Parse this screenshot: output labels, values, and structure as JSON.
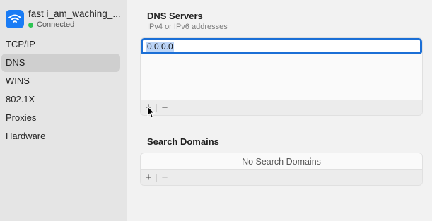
{
  "network": {
    "name": "fast i_am_waching_...",
    "status": "Connected"
  },
  "sidebar": {
    "items": [
      {
        "label": "TCP/IP",
        "selected": false
      },
      {
        "label": "DNS",
        "selected": true
      },
      {
        "label": "WINS",
        "selected": false
      },
      {
        "label": "802.1X",
        "selected": false
      },
      {
        "label": "Proxies",
        "selected": false
      },
      {
        "label": "Hardware",
        "selected": false
      }
    ]
  },
  "dns": {
    "title": "DNS Servers",
    "subtitle": "IPv4 or IPv6 addresses",
    "entries": [
      "0.0.0.0"
    ],
    "add_label": "+",
    "remove_label": "−"
  },
  "search_domains": {
    "title": "Search Domains",
    "empty_label": "No Search Domains",
    "add_label": "+",
    "remove_label": "−"
  },
  "colors": {
    "accent": "#1b6fd6",
    "wifi_badge": "#1a7cf5",
    "status_ok": "#2fc454"
  }
}
